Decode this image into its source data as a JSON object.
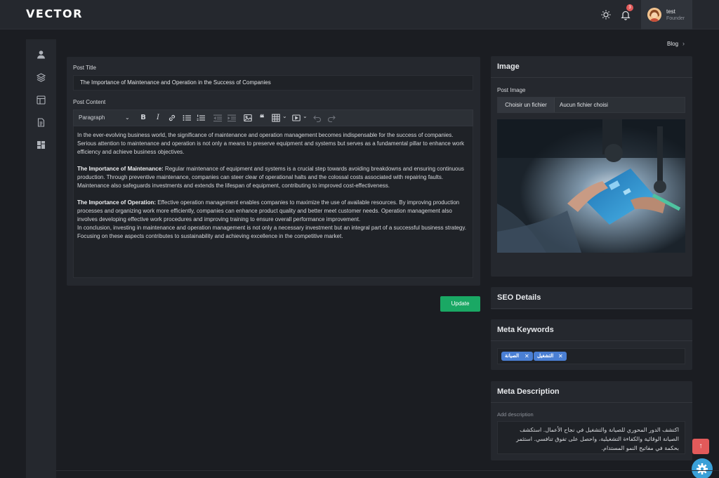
{
  "brand": {
    "logo_text": "VECTOR"
  },
  "topbar": {
    "theme_icon": "sun-icon",
    "notification_icon": "bell-icon",
    "notification_count": "3",
    "user": {
      "name": "test",
      "role": "Founder"
    }
  },
  "sidebar": {
    "items": [
      {
        "icon": "user-icon"
      },
      {
        "icon": "layers-icon"
      },
      {
        "icon": "layout-icon"
      },
      {
        "icon": "document-icon"
      },
      {
        "icon": "grid-icon"
      }
    ]
  },
  "breadcrumb": {
    "current": "Blog",
    "separator_icon": "chevron-right-icon"
  },
  "editor": {
    "title_label": "Post Title",
    "title_value": "The Importance of Maintenance and Operation in the Success of Companies",
    "content_label": "Post Content",
    "paragraph_select": "Paragraph",
    "content": {
      "p1": "In the ever-evolving business world, the significance of maintenance and operation management becomes indispensable for the success of companies. Serious attention to maintenance and operation is not only a means to preserve equipment and systems but serves as a fundamental pillar to enhance work efficiency and achieve business objectives.",
      "p2_bold": "The Importance of Maintenance:",
      "p2": " Regular maintenance of equipment and systems is a crucial step towards avoiding breakdowns and ensuring continuous production. Through preventive maintenance, companies can steer clear of operational halts and the colossal costs associated with repairing faults. Maintenance also safeguards investments and extends the lifespan of equipment, contributing to improved cost-effectiveness.",
      "p3_bold": "The Importance of Operation:",
      "p3": " Effective operation management enables companies to maximize the use of available resources. By improving production processes and organizing work more efficiently, companies can enhance product quality and better meet customer needs. Operation management also involves developing effective work procedures and improving training to ensure overall performance improvement.",
      "p4": "In conclusion, investing in maintenance and operation management is not only a necessary investment but an integral part of a successful business strategy. Focusing on these aspects contributes to sustainability and achieving excellence in the competitive market."
    },
    "update_label": "Update"
  },
  "image_card": {
    "title": "Image",
    "post_image_label": "Post Image",
    "choose_file_label": "Choisir un fichier",
    "no_file_label": "Aucun fichier choisi"
  },
  "seo": {
    "title": "SEO Details",
    "keywords_title": "Meta Keywords",
    "keywords": [
      "الصيانة",
      "التشغيل"
    ],
    "description_title": "Meta Description",
    "description_placeholder": "Add description",
    "description_value": "اكتشف الدور المحوري للصيانة والتشغيل في نجاح الأعمال. استكشف الصيانة الوقائية والكفاءة التشغيلية، واحصل على تفوق تنافسي. استثمر بحكمة في مفاتيح النمو المستدام."
  },
  "fab": {
    "scroll_top_icon": "arrow-up-icon",
    "settings_icon": "gear-icon"
  },
  "colors": {
    "accent_green": "#1aa864",
    "tag_blue": "#4a7fd4",
    "badge_red": "#e25a5a",
    "fab_blue": "#3aa0d8"
  }
}
